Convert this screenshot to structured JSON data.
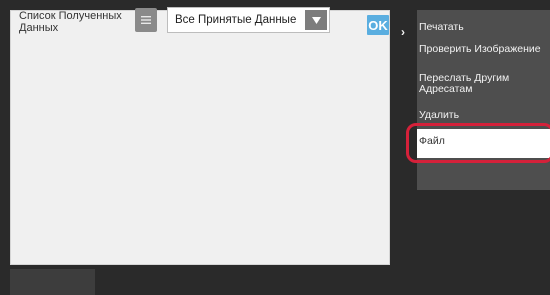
{
  "panel": {
    "list_title": "Список Полученных Данных",
    "filter_select_value": "Все Принятые Данные",
    "ok_label": "OK"
  },
  "menu": {
    "items": [
      {
        "label": "Печатать"
      },
      {
        "label": "Проверить Изображение"
      },
      {
        "label": "Переслать Другим Адресатам"
      },
      {
        "label": "Удалить"
      },
      {
        "label": "Файл",
        "highlighted": true
      }
    ]
  },
  "colors": {
    "accent": "#5aaee0",
    "highlight_ring": "#d5213a",
    "menu_bg": "#4e4e4e"
  },
  "icons": {
    "list_view": "list-icon",
    "dropdown": "triangle-down-icon",
    "expand": "chevron-right-icon"
  }
}
